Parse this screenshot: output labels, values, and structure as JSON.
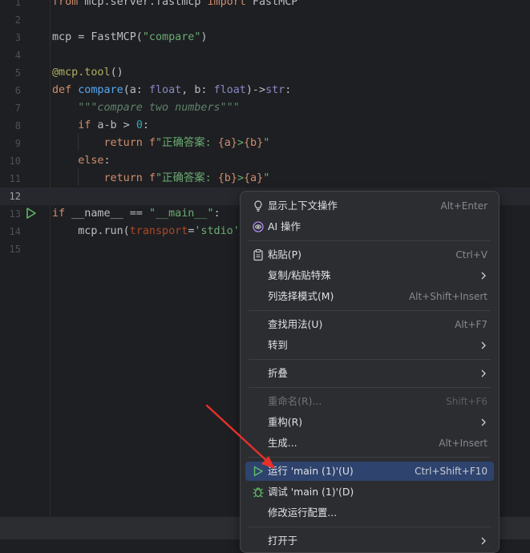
{
  "editor": {
    "lines": [
      {
        "n": "1"
      },
      {
        "n": "2"
      },
      {
        "n": "3"
      },
      {
        "n": "4"
      },
      {
        "n": "5"
      },
      {
        "n": "6"
      },
      {
        "n": "7"
      },
      {
        "n": "8"
      },
      {
        "n": "9"
      },
      {
        "n": "10"
      },
      {
        "n": "11"
      },
      {
        "n": "12"
      },
      {
        "n": "13"
      },
      {
        "n": "14"
      },
      {
        "n": "15"
      }
    ],
    "code": {
      "l1_kw1": "from",
      "l1_mod": " mcp.server.fastmcp ",
      "l1_kw2": "import",
      "l1_name": " FastMCP",
      "l3_a": "mcp = FastMCP(",
      "l3_str": "\"compare\"",
      "l3_b": ")",
      "l5_dec": "@mcp.tool",
      "l5_b": "()",
      "l6_kw": "def",
      "l6_fn": "compare",
      "l6_a": "(a: ",
      "l6_t1": "float",
      "l6_b": ", b: ",
      "l6_t2": "float",
      "l6_c": ")->",
      "l6_t3": "str",
      "l6_d": ":",
      "l7_doc": "\"\"\"compare two numbers\"\"\"",
      "l8_kw": "if",
      "l8_a": " a-b > ",
      "l8_num": "0",
      "l8_b": ":",
      "l9_kw": "return",
      "l9_f": " f",
      "l9_s1": "\"正确答案: ",
      "l9_v1": "{a}",
      "l9_s2": ">",
      "l9_v2": "{b}",
      "l9_s3": "\"",
      "l10_kw": "else",
      "l10_b": ":",
      "l11_kw": "return",
      "l11_f": " f",
      "l11_s1": "\"正确答案: ",
      "l11_v1": "{b}",
      "l11_s2": ">",
      "l11_v2": "{a}",
      "l11_s3": "\"",
      "l13_kw": "if",
      "l13_a": " __name__ == ",
      "l13_str": "\"__main__\"",
      "l13_b": ":",
      "l14_a": "mcp.run(",
      "l14_p": "transport",
      "l14_b": "=",
      "l14_str": "'stdio'"
    }
  },
  "menu": {
    "items": [
      {
        "label": "显示上下文操作",
        "shortcut": "Alt+Enter",
        "icon": "bulb-icon"
      },
      {
        "label": "AI 操作",
        "shortcut": "",
        "icon": "ai-icon"
      },
      {
        "label": "粘贴(P)",
        "shortcut": "Ctrl+V",
        "icon": "clipboard-icon"
      },
      {
        "label": "复制/粘贴特殊",
        "shortcut": "",
        "submenu": true
      },
      {
        "label": "列选择模式(M)",
        "shortcut": "Alt+Shift+Insert"
      },
      {
        "label": "查找用法(U)",
        "shortcut": "Alt+F7"
      },
      {
        "label": "转到",
        "shortcut": "",
        "submenu": true
      },
      {
        "label": "折叠",
        "shortcut": "",
        "submenu": true
      },
      {
        "label": "重命名(R)...",
        "shortcut": "Shift+F6",
        "disabled": true
      },
      {
        "label": "重构(R)",
        "shortcut": "",
        "submenu": true
      },
      {
        "label": "生成...",
        "shortcut": "Alt+Insert"
      },
      {
        "label": "运行 'main (1)'(U)",
        "shortcut": "Ctrl+Shift+F10",
        "icon": "run-icon",
        "highlighted": true
      },
      {
        "label": "调试 'main (1)'(D)",
        "shortcut": "",
        "icon": "debug-bug-icon"
      },
      {
        "label": "修改运行配置...",
        "shortcut": ""
      },
      {
        "label": "打开于",
        "shortcut": "",
        "submenu": true
      }
    ]
  },
  "colors": {
    "editor_bg": "#1e1f22",
    "menu_bg": "#2b2d30",
    "highlight": "#2e436e",
    "keyword": "#cf8e6d",
    "string": "#6aab73",
    "function": "#56a8f5",
    "run_green": "#5fb865",
    "annotation_arrow": "#e8302a"
  }
}
